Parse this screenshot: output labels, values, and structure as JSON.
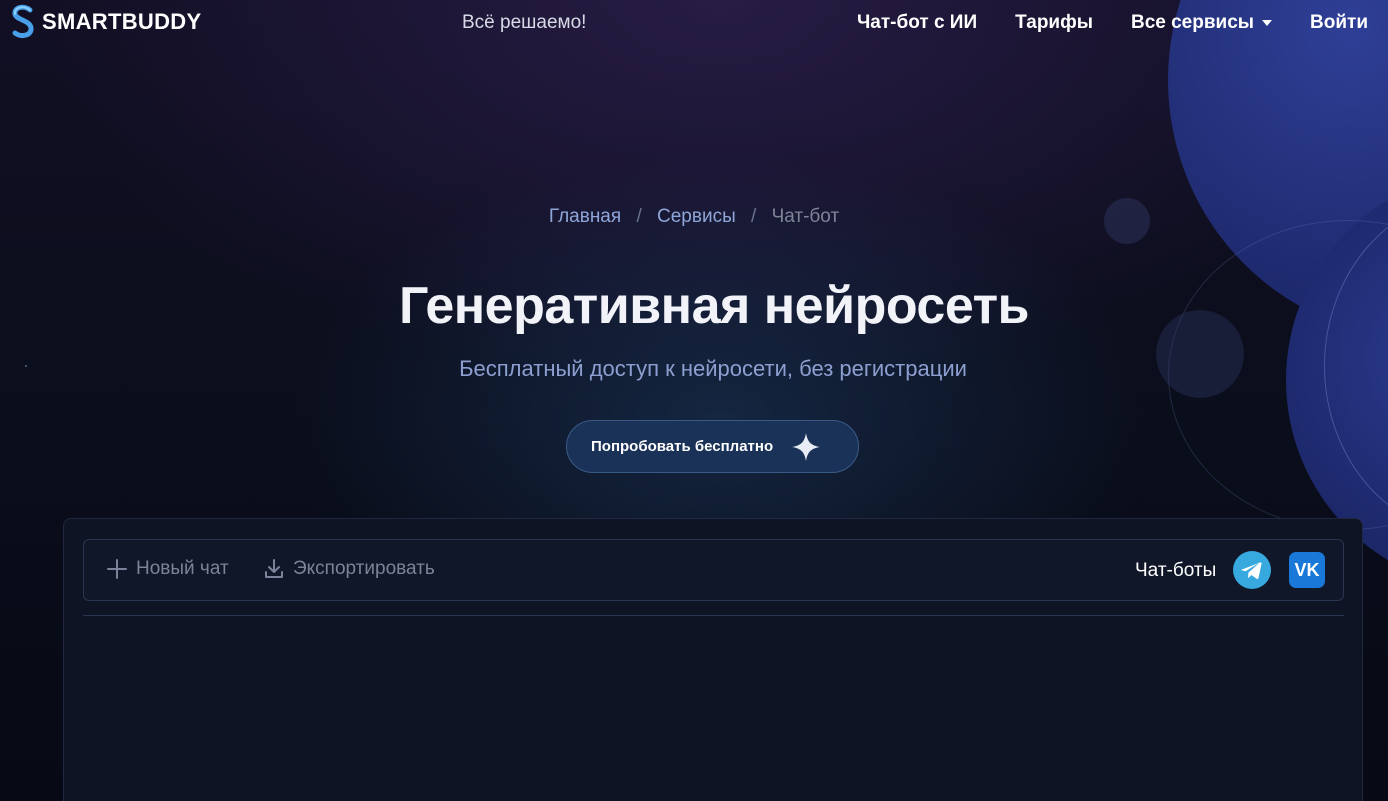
{
  "header": {
    "logo_text": "SMARTBUDDY",
    "tagline": "Всё решаемо!",
    "nav": [
      {
        "label": "Чат-бот с ИИ"
      },
      {
        "label": "Тарифы"
      },
      {
        "label": "Все сервисы"
      },
      {
        "label": "Войти"
      }
    ]
  },
  "breadcrumb": {
    "items": [
      {
        "label": "Главная"
      },
      {
        "label": "Сервисы"
      },
      {
        "label": "Чат-бот"
      }
    ],
    "separator": "/"
  },
  "hero": {
    "title": "Генеративная нейросеть",
    "subtitle": "Бесплатный доступ к нейросети, без регистрации",
    "cta_label": "Попробовать бесплатно"
  },
  "chat": {
    "new_chat_label": "Новый чат",
    "export_label": "Экспортировать",
    "bots_label": "Чат-боты",
    "vk_label": "VK"
  },
  "colors": {
    "accent": "#37a9df",
    "vk": "#1a78d8",
    "cta_bg": "#1a3257",
    "breadcrumb_link": "#8fa6d8"
  }
}
